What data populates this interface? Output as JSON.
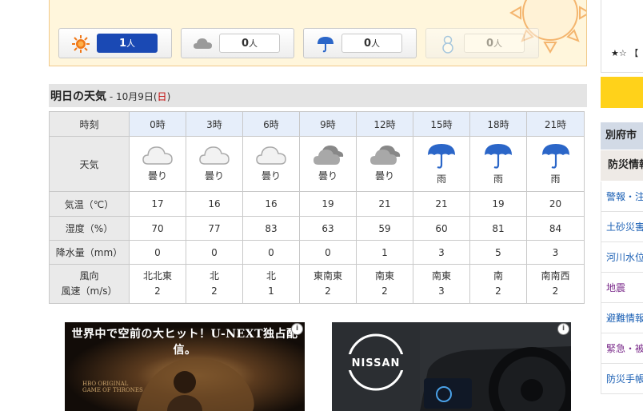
{
  "vote": {
    "buttons": [
      {
        "icon": "sun-icon",
        "count": "1",
        "unit": "人",
        "active": true
      },
      {
        "icon": "cloud-icon",
        "count": "0",
        "unit": "人",
        "active": false
      },
      {
        "icon": "umbrella-icon",
        "count": "0",
        "unit": "人",
        "active": false
      },
      {
        "icon": "snowman-icon",
        "count": "0",
        "unit": "人",
        "active": false
      }
    ]
  },
  "forecast": {
    "title": "明日の天気",
    "date_prefix": " - 10月9日(",
    "weekday": "日",
    "date_suffix": ")",
    "row_labels": {
      "time": "時刻",
      "weather": "天気",
      "temp": "気温（℃）",
      "humidity": "湿度（%）",
      "precip": "降水量（mm）",
      "wind_dir": "風向",
      "wind_speed": "風速（m/s）"
    },
    "hours": [
      "0時",
      "3時",
      "6時",
      "9時",
      "12時",
      "15時",
      "18時",
      "21時"
    ],
    "weather": [
      "曇り",
      "曇り",
      "曇り",
      "曇り",
      "曇り",
      "雨",
      "雨",
      "雨"
    ],
    "weather_icons": [
      "cloud-light-icon",
      "cloud-light-icon",
      "cloud-light-icon",
      "cloud-dark-icon",
      "cloud-dark-icon",
      "umbrella-icon",
      "umbrella-icon",
      "umbrella-icon"
    ],
    "temp": [
      "17",
      "16",
      "16",
      "19",
      "21",
      "21",
      "19",
      "20"
    ],
    "humidity": [
      "70",
      "77",
      "83",
      "63",
      "59",
      "60",
      "81",
      "84"
    ],
    "precip": [
      "0",
      "0",
      "0",
      "0",
      "1",
      "3",
      "5",
      "3"
    ],
    "wind_dir": [
      "北北東",
      "北",
      "北",
      "東南東",
      "南東",
      "南東",
      "南",
      "南南西"
    ],
    "wind_speed": [
      "2",
      "2",
      "1",
      "2",
      "2",
      "3",
      "2",
      "2"
    ]
  },
  "ads": {
    "left_headline": "世界中で空前の大ヒット！U-NEXT独占配信。",
    "left_logo_line1": "HBO ORIGINAL",
    "left_logo_line2": "GAME OF THRONES",
    "right_brand": "NISSAN",
    "info_glyph": "i"
  },
  "sidebar": {
    "card_stars": "★☆ 【",
    "menu_title": "別府市",
    "menu_sub": "防災情報",
    "links": [
      "警報・注",
      "土砂災害",
      "河川水位",
      "地震",
      "避難情報",
      "緊急・被",
      "防災手帳"
    ]
  },
  "colors": {
    "vote_active": "#1a49b4",
    "link_blue": "#1a5fb4",
    "link_purple": "#7a2a8a",
    "sunday_red": "#c00000",
    "umbrella_blue": "#2b66c8"
  }
}
